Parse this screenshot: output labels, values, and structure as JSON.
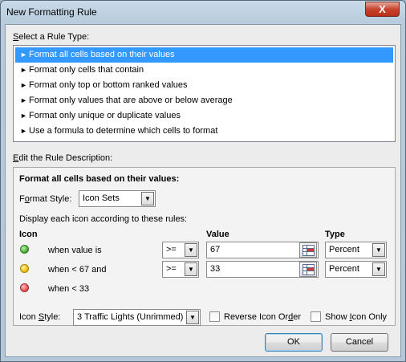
{
  "window": {
    "title": "New Formatting Rule",
    "close_label": "X"
  },
  "rule_type": {
    "label_underline": "S",
    "label_rest": "elect a Rule Type:",
    "items": [
      "Format all cells based on their values",
      "Format only cells that contain",
      "Format only top or bottom ranked values",
      "Format only values that are above or below average",
      "Format only unique or duplicate values",
      "Use a formula to determine which cells to format"
    ],
    "selected_index": 0
  },
  "description": {
    "label_underline": "E",
    "label_rest": "dit the Rule Description:",
    "heading": "Format all cells based on their values:",
    "format_style_pre": "F",
    "format_style_underline": "o",
    "format_style_post": "rmat Style:",
    "format_style_value": "Icon Sets",
    "display_rules": "Display each icon according to these rules:",
    "col_icon": "Icon",
    "col_value": "Value",
    "col_type": "Type",
    "rows": [
      {
        "icon": "green-circle",
        "text": "when value is",
        "op": ">=",
        "value": "67",
        "type": "Percent"
      },
      {
        "icon": "yellow-circle",
        "text": "when < 67 and",
        "op": ">=",
        "value": "33",
        "type": "Percent"
      },
      {
        "icon": "red-circle",
        "text": "when < 33"
      }
    ],
    "icon_style_pre": "Icon ",
    "icon_style_underline": "S",
    "icon_style_post": "tyle:",
    "icon_style_value": "3 Traffic Lights (Unrimmed)",
    "reverse_pre": "Reverse Icon Or",
    "reverse_underline": "d",
    "reverse_post": "er",
    "show_pre": "Show ",
    "show_underline": "I",
    "show_post": "con Only"
  },
  "buttons": {
    "ok": "OK",
    "cancel": "Cancel"
  },
  "colors": {
    "selection": "#3399ff",
    "title_bg": "#c9dbea"
  }
}
